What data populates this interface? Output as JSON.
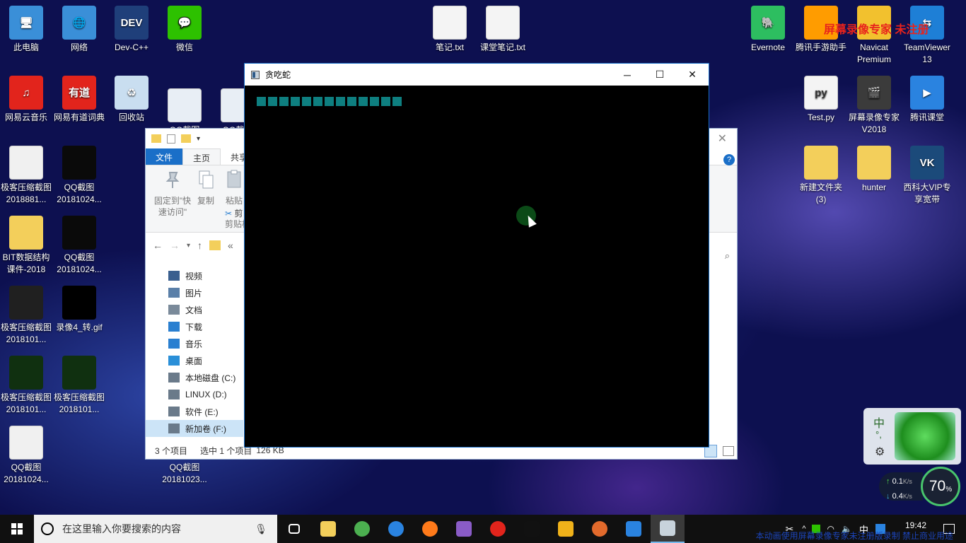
{
  "desktop": {
    "icons": [
      {
        "label": "此电脑",
        "color": "#3a8fd8",
        "glyph": "🖥"
      },
      {
        "label": "网络",
        "color": "#3a8fd8",
        "glyph": "🌐"
      },
      {
        "label": "Dev-C++",
        "color": "#1f3f7a",
        "glyph": "DEV"
      },
      {
        "label": "微信",
        "color": "#2dc100",
        "glyph": "💬"
      },
      {
        "label": "笔记.txt",
        "color": "#f4f4f4",
        "glyph": ""
      },
      {
        "label": "课堂笔记.txt",
        "color": "#f4f4f4",
        "glyph": ""
      },
      {
        "label": "Evernote",
        "color": "#2dbe60",
        "glyph": "🐘"
      },
      {
        "label": "腾讯手游助手",
        "color": "#ff9c00",
        "glyph": ""
      },
      {
        "label": "Navicat Premium",
        "color": "#f2c12e",
        "glyph": ""
      },
      {
        "label": "TeamViewer 13",
        "color": "#1e7fd6",
        "glyph": "⇆"
      },
      {
        "label": "网易云音乐",
        "color": "#e2241c",
        "glyph": "♫"
      },
      {
        "label": "网易有道词典",
        "color": "#e2241c",
        "glyph": "有道"
      },
      {
        "label": "回收站",
        "color": "#c9def0",
        "glyph": "♻"
      },
      {
        "label": "QQ截图20181023...",
        "color": "#e8eef5",
        "glyph": ""
      },
      {
        "label": "QQ截图20181024...",
        "color": "#e8eef5",
        "glyph": ""
      },
      {
        "label": "Test.py",
        "color": "#f4f4f4",
        "glyph": "py"
      },
      {
        "label": "屏幕录像专家V2018",
        "color": "#3b3b3b",
        "glyph": "🎬"
      },
      {
        "label": "腾讯课堂",
        "color": "#2a83e0",
        "glyph": "▶"
      },
      {
        "label": "极客压缩截图2018881...",
        "color": "#f0f0f0",
        "glyph": ""
      },
      {
        "label": "QQ截图20181024...",
        "color": "#0a0a0a",
        "glyph": ""
      },
      {
        "label": "新建文件夹(3)",
        "color": "#f3cf5b",
        "glyph": ""
      },
      {
        "label": "hunter",
        "color": "#f3cf5b",
        "glyph": ""
      },
      {
        "label": "西科大VIP专享宽带",
        "color": "#1b4a7a",
        "glyph": "VK"
      },
      {
        "label": "BIT数据结构课件-2018",
        "color": "#f3cf5b",
        "glyph": ""
      },
      {
        "label": "QQ截图20181024...",
        "color": "#0a0a0a",
        "glyph": ""
      },
      {
        "label": "极客压缩截图2018101...",
        "color": "#202020",
        "glyph": ""
      },
      {
        "label": "录像4_转.gif",
        "color": "#000000",
        "glyph": ""
      },
      {
        "label": "极客压缩截图2018101...",
        "color": "#103010",
        "glyph": ""
      },
      {
        "label": "极客压缩截图2018101...",
        "color": "#103010",
        "glyph": ""
      },
      {
        "label": "QQ截图20181024...",
        "color": "#f0f0f0",
        "glyph": ""
      },
      {
        "label": "QQ截图20181023...",
        "color": "#f0f0f0",
        "glyph": ""
      }
    ]
  },
  "watermark": {
    "top": "屏幕录像专家  未注册",
    "bottom": "本动画使用屏幕录像专家未注册版录制  禁止商业用途"
  },
  "explorer": {
    "ribbon_tabs": {
      "file": "文件",
      "home": "主页",
      "share": "共享"
    },
    "ribbon": {
      "pin": "固定到\"快速访问\"",
      "copy": "复制",
      "paste": "粘贴",
      "cut": "剪",
      "clipboard": "剪贴板"
    },
    "address": "«",
    "nav": [
      {
        "label": "视频",
        "color": "#3a5f8f"
      },
      {
        "label": "图片",
        "color": "#5a7fa8"
      },
      {
        "label": "文档",
        "color": "#7a8a9a"
      },
      {
        "label": "下载",
        "color": "#2a7fd0"
      },
      {
        "label": "音乐",
        "color": "#2a7fd0"
      },
      {
        "label": "桌面",
        "color": "#2a8fd8"
      },
      {
        "label": "本地磁盘 (C:)",
        "color": "#6a7a8a"
      },
      {
        "label": "LINUX (D:)",
        "color": "#6a7a8a"
      },
      {
        "label": "软件 (E:)",
        "color": "#6a7a8a"
      },
      {
        "label": "新加卷 (F:)",
        "color": "#6a7a8a"
      }
    ],
    "selected_nav": 9,
    "status": {
      "items": "3 个项目",
      "selected": "选中 1 个项目",
      "size": "126 KB"
    }
  },
  "snake_window": {
    "title": "贪吃蛇",
    "snake_length": 13,
    "snake_color": "#0e7f80"
  },
  "widget": {
    "ime": "中",
    "punct": "°,",
    "upload": "0.1",
    "upload_unit": "K/s",
    "download": "0.4",
    "download_unit": "K/s",
    "gauge": "70",
    "gauge_unit": "%"
  },
  "taskbar": {
    "search_placeholder": "在这里输入你要搜索的内容",
    "apps": [
      {
        "name": "task-view",
        "color": "#ffffff"
      },
      {
        "name": "file-explorer",
        "color": "#f3cf5b"
      },
      {
        "name": "chrome",
        "color": "#4caf50"
      },
      {
        "name": "edge",
        "color": "#2a83e0"
      },
      {
        "name": "firefox",
        "color": "#ff7a1a"
      },
      {
        "name": "visual-studio",
        "color": "#8a5cc7"
      },
      {
        "name": "netease-music",
        "color": "#e2241c"
      },
      {
        "name": "qq",
        "color": "#111111"
      },
      {
        "name": "app-yellow",
        "color": "#f0b21a"
      },
      {
        "name": "snail",
        "color": "#e26a2c"
      },
      {
        "name": "app-w",
        "color": "#2a83e0"
      },
      {
        "name": "console-app",
        "color": "#c8d3dc"
      }
    ],
    "time": "19:42",
    "tray_ime": "中"
  }
}
